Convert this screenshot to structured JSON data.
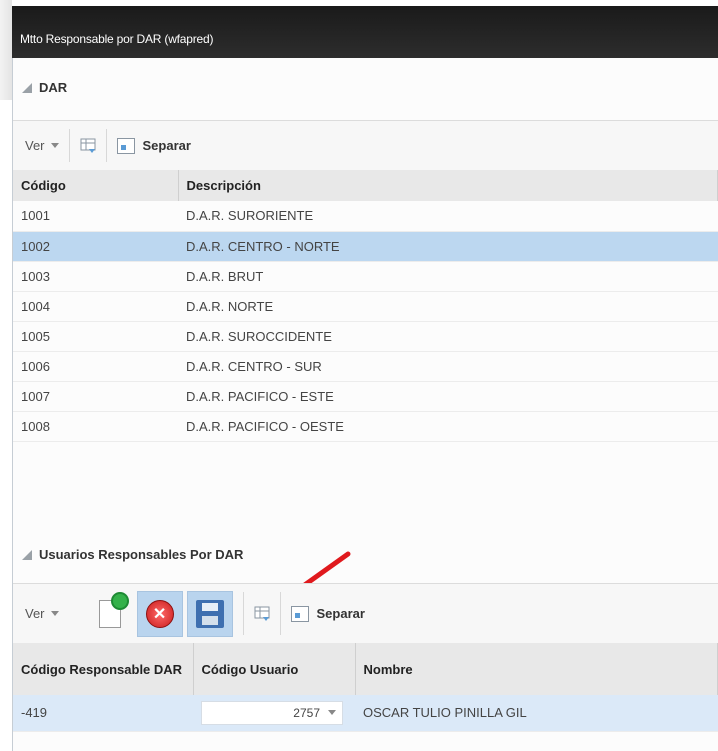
{
  "window": {
    "title": "Mtto Responsable por DAR (wfapred)"
  },
  "dar_section": {
    "heading": "DAR",
    "toolbar": {
      "view_label": "Ver",
      "detach_label": "Separar"
    },
    "columns": [
      "Código",
      "Descripción"
    ],
    "rows": [
      {
        "code": "1001",
        "description": "D.A.R. SURORIENTE"
      },
      {
        "code": "1002",
        "description": "D.A.R. CENTRO - NORTE"
      },
      {
        "code": "1003",
        "description": "D.A.R. BRUT"
      },
      {
        "code": "1004",
        "description": "D.A.R. NORTE"
      },
      {
        "code": "1005",
        "description": "D.A.R. SUROCCIDENTE"
      },
      {
        "code": "1006",
        "description": "D.A.R. CENTRO - SUR"
      },
      {
        "code": "1007",
        "description": "D.A.R. PACIFICO - ESTE"
      },
      {
        "code": "1008",
        "description": "D.A.R. PACIFICO - OESTE"
      }
    ],
    "selected_row": 1
  },
  "users_section": {
    "heading": "Usuarios Responsables Por DAR",
    "toolbar": {
      "view_label": "Ver",
      "detach_label": "Separar"
    },
    "columns": [
      "Código Responsable DAR",
      "Código Usuario",
      "Nombre"
    ],
    "rows": [
      {
        "responsible_code": "-419",
        "user_code": "2757",
        "name": "OSCAR TULIO PINILLA GIL"
      }
    ]
  },
  "colors": {
    "selected_row": "#bcd7f0",
    "title_bar": "#1a1a1a",
    "annotation_arrow": "#e0191d"
  }
}
